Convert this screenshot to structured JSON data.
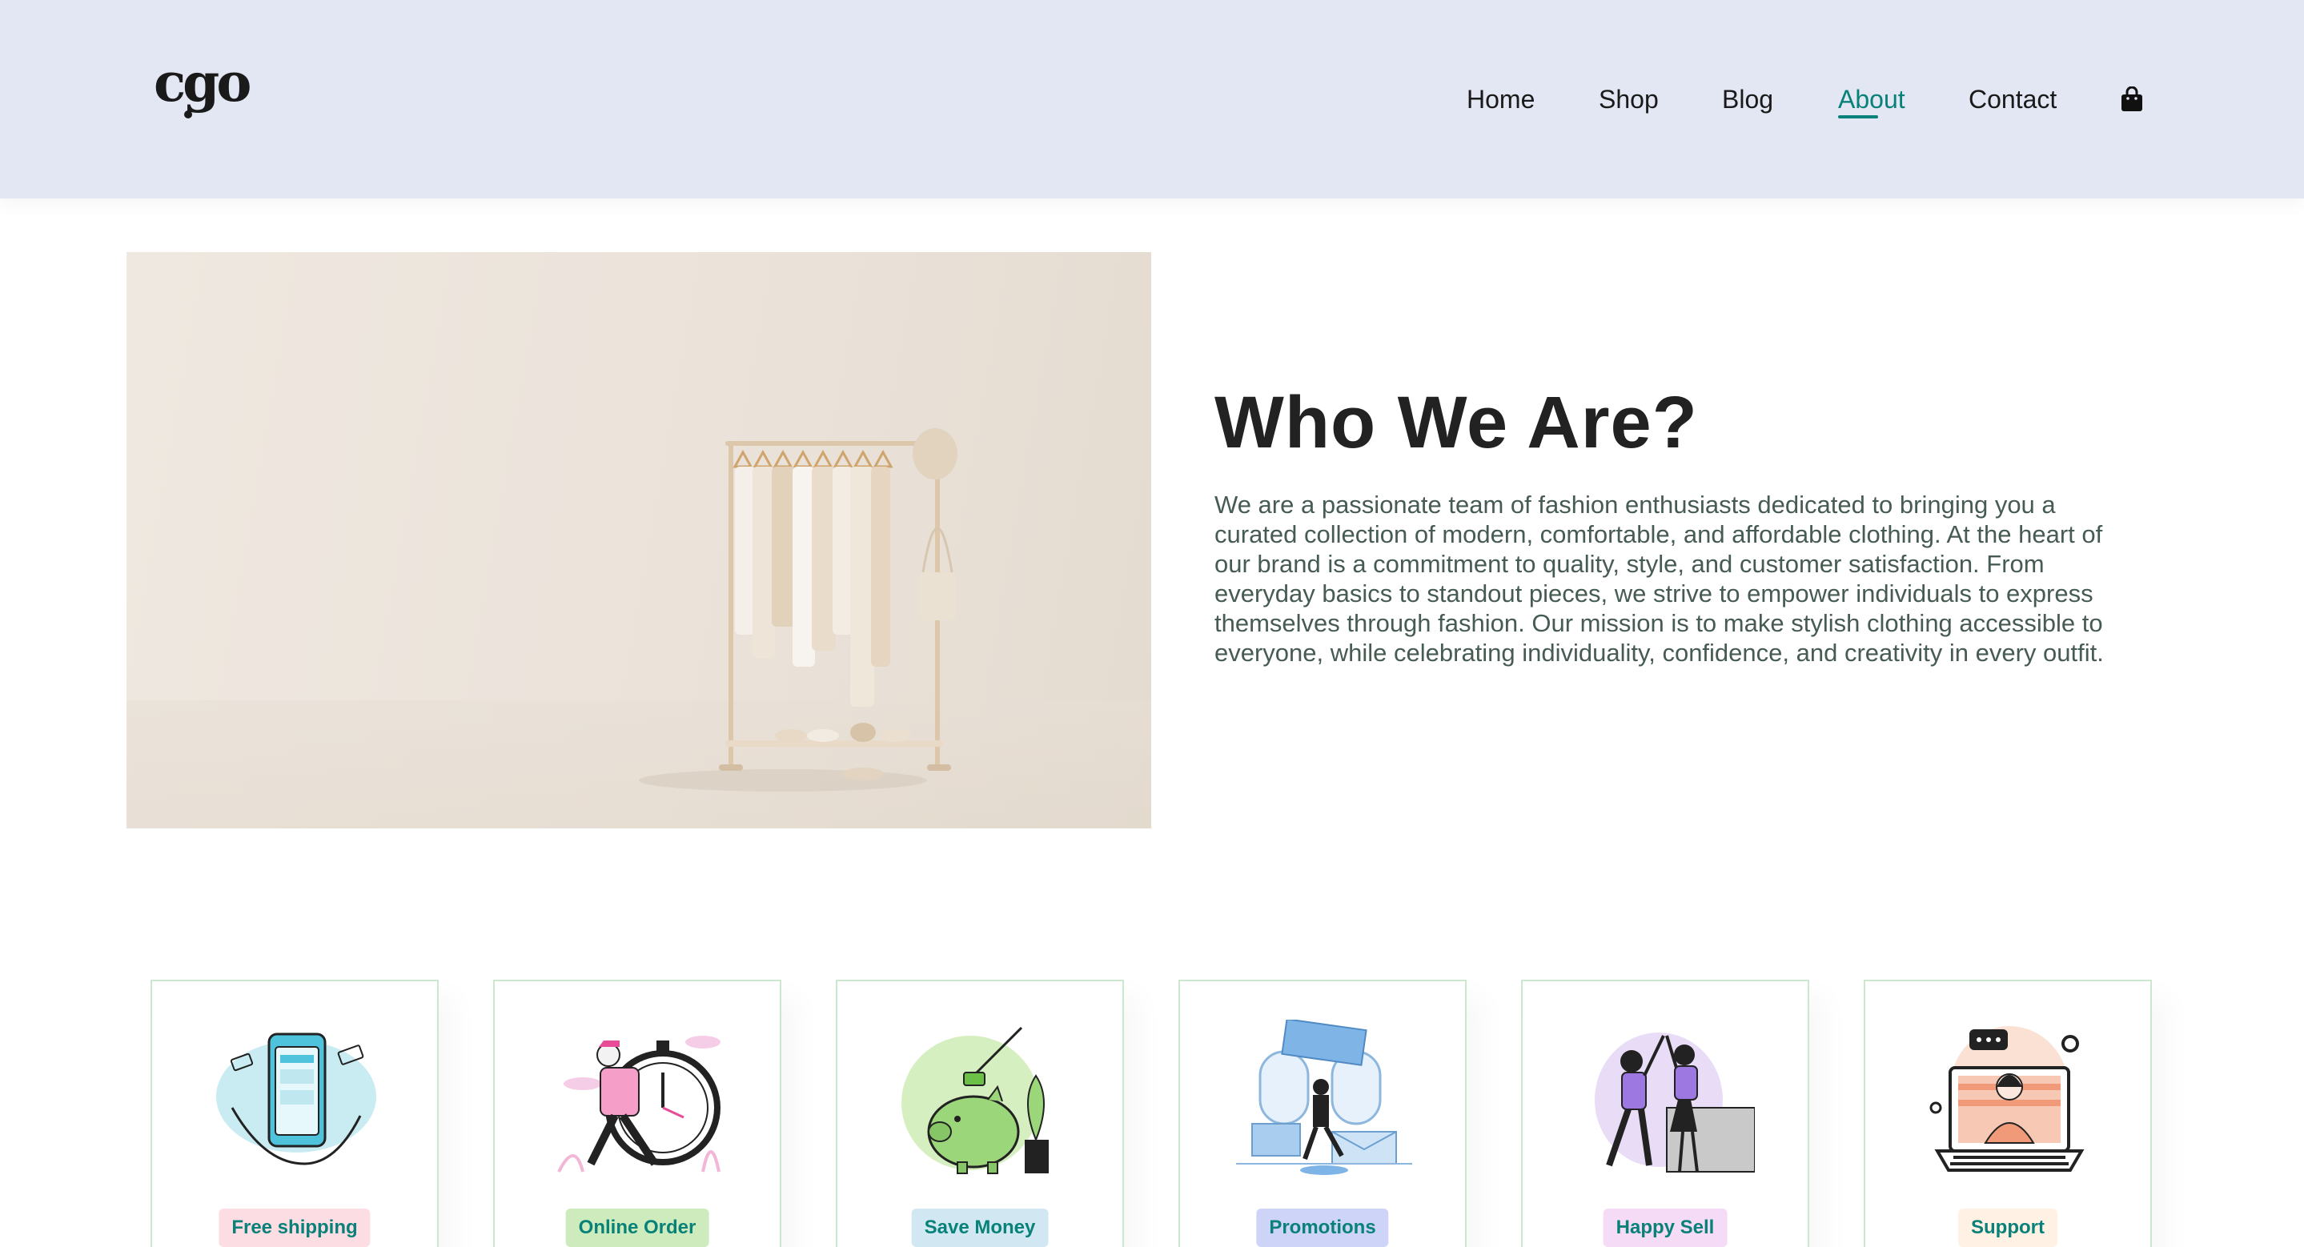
{
  "header": {
    "logo_text": "cgo",
    "nav": [
      {
        "label": "Home"
      },
      {
        "label": "Shop"
      },
      {
        "label": "Blog"
      },
      {
        "label": "About"
      },
      {
        "label": "Contact"
      }
    ],
    "active_nav": "About",
    "cart_icon": "shopping-bag-icon"
  },
  "about": {
    "title": "Who We Are?",
    "text": "We are a passionate team of fashion enthusiasts dedicated to bringing you a curated collection of modern, comfortable, and affordable clothing. At the heart of our brand is a commitment to quality, style, and customer satisfaction. From everyday basics to standout pieces, we strive to empower individuals to express themselves through fashion. Our mission is to make stylish clothing accessible to everyone, while celebrating individuality, confidence, and creativity in every outfit."
  },
  "features": [
    {
      "label": "Free shipping",
      "badge_color": "#fddde4",
      "icon": "phone-payment-icon"
    },
    {
      "label": "Online Order",
      "badge_color": "#cdebbc",
      "icon": "delivery-clock-icon"
    },
    {
      "label": "Save Money",
      "badge_color": "#d1e8f2",
      "icon": "piggy-bank-icon"
    },
    {
      "label": "Promotions",
      "badge_color": "#cdd4f8",
      "icon": "promotion-gift-icon"
    },
    {
      "label": "Happy Sell",
      "badge_color": "#f6dbf6",
      "icon": "high-five-icon"
    },
    {
      "label": "Support",
      "badge_color": "#fff2e5",
      "icon": "support-laptop-icon"
    }
  ],
  "colors": {
    "accent": "#088178",
    "header_bg": "#e3e6f3",
    "card_border": "#cce7d0"
  }
}
